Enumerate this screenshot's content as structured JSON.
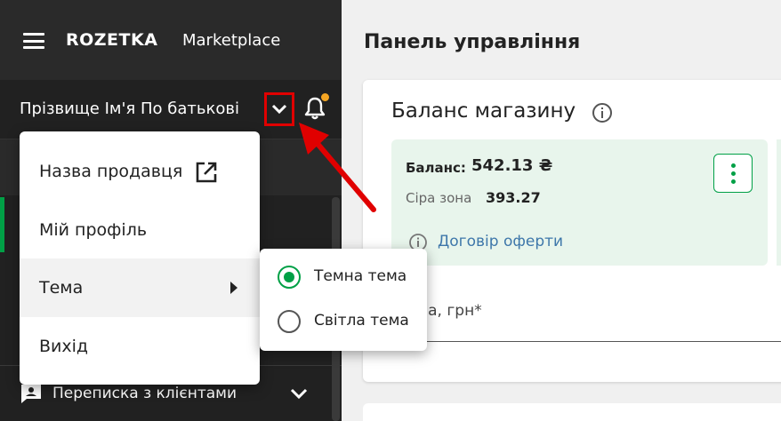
{
  "header": {
    "brand_bold": "ROZETKA",
    "brand_light": "Marketplace",
    "user_name": "Прізвище Ім'я По батькові"
  },
  "sidebar": {
    "chat_label": "Переписка з клієнтами"
  },
  "account_menu": {
    "items": [
      {
        "label": "Назва продавця"
      },
      {
        "label": "Мій профіль"
      },
      {
        "label": "Тема"
      },
      {
        "label": "Вихід"
      }
    ]
  },
  "theme_menu": {
    "options": [
      {
        "label": "Темна тема",
        "selected": true
      },
      {
        "label": "Світла тема",
        "selected": false
      }
    ]
  },
  "main": {
    "page_title": "Панель управління",
    "balance_card": {
      "title": "Баланс магазину",
      "balance_label": "Баланс:",
      "balance_value": "542.13 ₴",
      "grey_zone_label": "Сіра зона",
      "grey_zone_value": "393.27",
      "offer_link": "Договір оферти",
      "price_label": "на, грн*"
    }
  },
  "icons": [
    "menu-icon",
    "chevron-down-icon",
    "bell-icon",
    "external-link-icon",
    "info-icon",
    "more-vertical-icon",
    "chat-icon"
  ],
  "colors": {
    "sidebar_bg": "#212121",
    "accent_green": "#00a046",
    "highlight_red": "#e00000",
    "link_blue": "#3e77aa",
    "balance_panel": "#e8f5ec",
    "notification_dot": "#f5a623"
  }
}
